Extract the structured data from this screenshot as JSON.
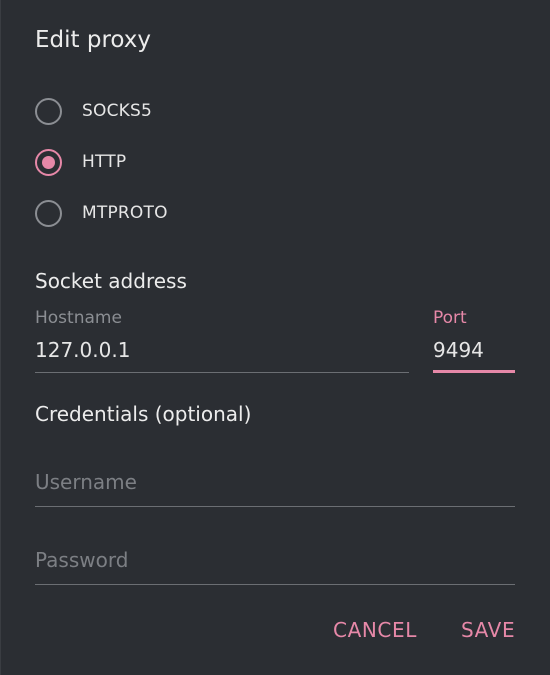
{
  "dialog": {
    "title": "Edit proxy"
  },
  "proxy_types": [
    {
      "label": "SOCKS5",
      "checked": false
    },
    {
      "label": "HTTP",
      "checked": true
    },
    {
      "label": "MTPROTO",
      "checked": false
    }
  ],
  "socket": {
    "heading": "Socket address",
    "hostname_label": "Hostname",
    "hostname_value": "127.0.0.1",
    "port_label": "Port",
    "port_value": "9494"
  },
  "credentials": {
    "heading": "Credentials (optional)",
    "username_placeholder": "Username",
    "password_placeholder": "Password"
  },
  "buttons": {
    "cancel": "CANCEL",
    "save": "SAVE"
  },
  "colors": {
    "accent": "#e688a8",
    "background": "#2b2e33",
    "text": "#e6e6e6",
    "muted": "#8b8e93"
  }
}
